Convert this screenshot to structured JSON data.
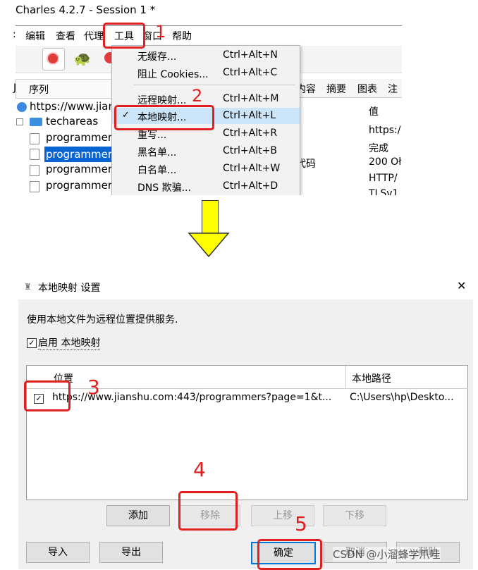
{
  "top_window": {
    "title": "Charles 4.2.7 - Session 1 *",
    "menu": [
      "编辑",
      "查看",
      "代理",
      "工具",
      "窗口",
      "帮助"
    ],
    "left_tab_label": "序列",
    "tree": [
      "https://www.jian",
      "techareas",
      "programmer",
      "programmer",
      "programmer",
      "programmer"
    ],
    "right_tabs": [
      "内容",
      "摘要",
      "图表",
      "注"
    ],
    "value_header": "值",
    "values": [
      "https:/",
      "完成",
      "200 Oł",
      "HTTP/",
      "TLSv1"
    ],
    "status_code_label": "代码",
    "tools_menu": [
      {
        "label": "无缓存...",
        "shortcut": "Ctrl+Alt+N"
      },
      {
        "label": "阻止 Cookies...",
        "shortcut": "Ctrl+Alt+C"
      },
      {
        "label": "远程映射...",
        "shortcut": "Ctrl+Alt+M"
      },
      {
        "label": "本地映射...",
        "shortcut": "Ctrl+Alt+L",
        "checked": true
      },
      {
        "label": "重写...",
        "shortcut": "Ctrl+Alt+R"
      },
      {
        "label": "黑名单...",
        "shortcut": "Ctrl+Alt+B"
      },
      {
        "label": "白名单...",
        "shortcut": "Ctrl+Alt+W"
      },
      {
        "label": "DNS 欺骗...",
        "shortcut": "Ctrl+Alt+D"
      }
    ],
    "check_mark": "✓"
  },
  "annotations": [
    "1",
    "2",
    "3",
    "4",
    "5"
  ],
  "colors": {
    "annotation_red": "#e02020",
    "arrow_yellow": "#ffff00",
    "selection_blue": "#0a64d2",
    "menu_highlight": "#cce4f7"
  },
  "dialog": {
    "title": "本地映射 设置",
    "close_icon": "✕",
    "description": "使用本地文件为远程位置提供服务.",
    "enable_label": "启用 本地映射",
    "table": {
      "columns": [
        "位置",
        "本地路径"
      ],
      "rows": [
        {
          "location": "https://www.jianshu.com:443/programmers?page=1&t...",
          "local_path": "C:\\Users\\hp\\Deskto...",
          "checked": true
        }
      ]
    },
    "buttons": {
      "add": "添加",
      "remove": "移除",
      "up": "上移",
      "down": "下移",
      "import": "导入",
      "export": "导出",
      "ok": "确定",
      "cancel": "取消",
      "help": "帮助"
    },
    "watermark": "CSDN @小溜蜂学爪哇"
  }
}
